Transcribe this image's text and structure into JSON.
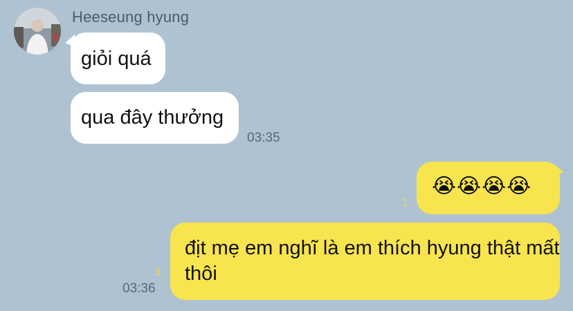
{
  "sender": {
    "name": "Heeseung hyung"
  },
  "messages": [
    {
      "text": "giỏi quá"
    },
    {
      "text": "qua đây thưởng",
      "time": "03:35"
    },
    {
      "text": "😭😭😭😭",
      "unread": "1"
    },
    {
      "text": "địt mẹ em nghĩ là em thích hyung thật mất thôi",
      "unread": "1",
      "time": "03:36"
    }
  ],
  "colors": {
    "background": "#aec2d2",
    "incoming_bubble": "#ffffff",
    "outgoing_bubble": "#f7e44f",
    "unread_count": "#f2d64a"
  }
}
